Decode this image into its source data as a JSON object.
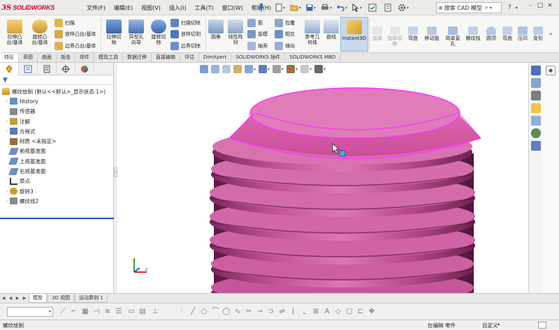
{
  "app": {
    "logo_ds": "3S",
    "logo_name": "SOLIDWORKS"
  },
  "menus": [
    "文件(F)",
    "编辑(E)",
    "视图(V)",
    "插入(I)",
    "工具(T)",
    "窗口(W)",
    "帮助(H)"
  ],
  "search": {
    "value": "搜索 CAD 模型"
  },
  "ribbon": {
    "extrude_boss": "拉伸凸\n台/基体",
    "revolve_boss": "旋转凸\n台/基体",
    "sweep": "扫描",
    "loft_boss": "放样凸台/基体",
    "boundary_boss": "边界凸台/基体",
    "extrude_cut": "拉伸切\n除",
    "hole_wizard": "异型孔\n向导",
    "revolve_cut": "旋转切\n除",
    "swept_cut": "扫描切除",
    "lofted_cut": "放样切割",
    "boundary_cut": "边界切除",
    "fillet": "圆角",
    "linear_pattern": "线性阵\n列",
    "rib": "筋",
    "draft": "拔模",
    "shell": "抽壳",
    "wrap": "包覆",
    "intersect": "相交",
    "mirror": "镜向",
    "reference_geometry": "参考几\n何体",
    "curves": "曲线",
    "instant3d": "Instant3D",
    "extrude_dim": "加厚",
    "thicken_cut": "加厚切\n除",
    "flex": "弯曲",
    "move_face": "移动面",
    "simple_hole": "简单直\n孔",
    "helix": "螺纹线",
    "dome": "圆顶",
    "bend": "弯曲",
    "indent": "压凹",
    "deform": "变形"
  },
  "command_tabs": [
    "特征",
    "草图",
    "曲面",
    "钣金",
    "焊件",
    "模具工具",
    "数据迁移",
    "直接编辑",
    "评估",
    "DimXpert",
    "SOLIDWORKS 插件",
    "SOLIDWORKS MBD"
  ],
  "tree": {
    "root": "螺纹绘制 (默认<<默认>_显示状态 1>)",
    "items": [
      {
        "label": "History",
        "expandable": true,
        "icon_color": "#6b8fc4"
      },
      {
        "label": "传感器",
        "expandable": false,
        "icon_color": "#8a8a8a"
      },
      {
        "label": "注解",
        "expandable": true,
        "icon_color": "#c0a040"
      },
      {
        "label": "方程式",
        "expandable": true,
        "icon_color": "#5a7ab8"
      },
      {
        "label": "材质 <未指定>",
        "expandable": false,
        "icon_color": "#9b6a3a"
      },
      {
        "label": "前视基准面",
        "expandable": false,
        "icon_color": "#6f8fbf"
      },
      {
        "label": "上视基准面",
        "expandable": false,
        "icon_color": "#6f8fbf"
      },
      {
        "label": "右视基准面",
        "expandable": false,
        "icon_color": "#6f8fbf"
      },
      {
        "label": "原点",
        "expandable": false,
        "icon_color": "#333333"
      },
      {
        "label": "旋转3",
        "expandable": true,
        "icon_color": "#c8a028"
      },
      {
        "label": "螺纹线2",
        "expandable": true,
        "icon_color": "#8a8a8a"
      }
    ]
  },
  "bottom_tabs": [
    "模型",
    "3D 视图",
    "运动算例 1"
  ],
  "status": {
    "left": "螺纹绘制",
    "mode": "在编辑 零件",
    "units": "自定义"
  },
  "colors": {
    "part": "#d24a9e",
    "edge": "#ff33ff",
    "accent": "#1c4fa8"
  }
}
